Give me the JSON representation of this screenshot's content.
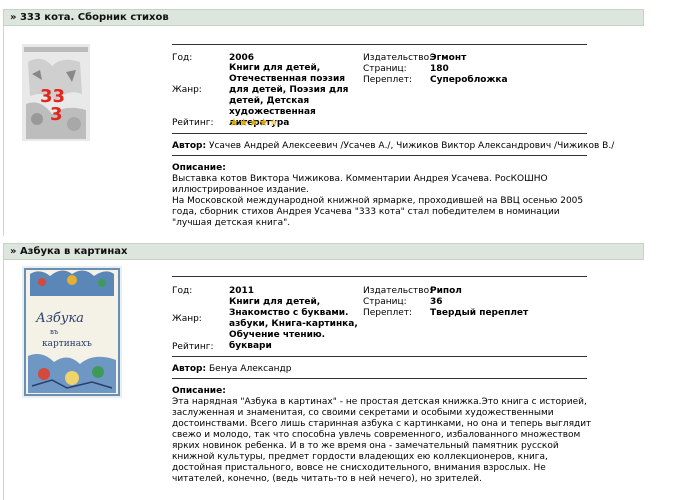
{
  "colors": {
    "header_bg": "#dde6dd",
    "accent_star": "#e0a800"
  },
  "books": [
    {
      "title": "» 333 кота. Сборник стихов",
      "labels": {
        "year": "Год:",
        "genre": "Жанр:",
        "rating": "Рейтинг:",
        "publisher": "Издательство:",
        "pages": "Страниц:",
        "binding": "Переплет:",
        "author": "Автор:",
        "description": "Описание:"
      },
      "year": "2006",
      "genre": "Книги для детей, Отечественная поэзия для детей, Поэзия для детей, Детская художественная литература",
      "rating_stars": 4,
      "publisher": "Эгмонт",
      "pages": "180",
      "binding": "Суперобложка",
      "author": "Усачев Андрей Алексеевич /Усачев А./, Чижиков Виктор Александрович /Чижиков В./",
      "description": "Выставка котов Виктора Чижикова. Комментарии Андрея Усачева. РосКОШНО иллюстрированное издание.\nНа Московской международной книжной ярмарке, проходившей на ВВЦ осенью 2005 года, сборник стихов Андрея Усачева \"333 кота\" стал победителем в номинации \"лучшая детская книга\".",
      "cover_text": "33 3"
    },
    {
      "title": "» Азбука в картинах",
      "labels": {
        "year": "Год:",
        "genre": "Жанр:",
        "rating": "Рейтинг:",
        "publisher": "Издательство:",
        "pages": "Страниц:",
        "binding": "Переплет:",
        "author": "Автор:",
        "description": "Описание:"
      },
      "year": "2011",
      "genre": "Книги для детей, Знакомство с буквами. азбуки, Книга-картинка, Обучение чтению. буквари",
      "rating_stars": 0,
      "publisher": "Рипол",
      "pages": "36",
      "binding": "Твердый переплет",
      "author": "Бенуа Александр",
      "description": "Эта нарядная \"Азбука в картинах\" - не простая детская книжка.Это книга с историей, заслуженная и знаменитая, со своими секретами и особыми художественными достоинствами. Всего лишь старинная азбука с картинками, но она и теперь выглядит свежо и молодо, так что способна увлечь современного, избалованного множеством ярких новинок ребенка. И в то же время она - замечательный памятник русской книжной культуры, предмет гордости владеющих ею коллекционеров, книга, достойная пристального, вовсе не снисходительного, внимания взрослых. Не читателей, конечно, (ведь читать-то в ней нечего), но зрителей.",
      "cover_text": "Азбука в картинахъ"
    }
  ]
}
